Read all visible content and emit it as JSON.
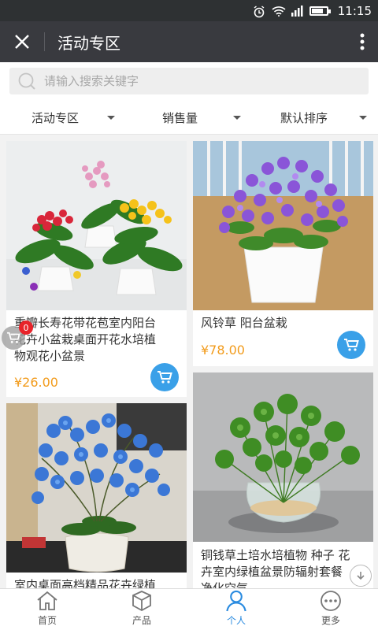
{
  "statusbar": {
    "time": "11:15",
    "icons": [
      "alarm-icon",
      "wifi-icon",
      "signal-icon",
      "battery-icon"
    ]
  },
  "titlebar": {
    "title": "活动专区",
    "close_icon": "close-icon",
    "more_icon": "more-vertical-icon"
  },
  "search": {
    "placeholder": "请输入搜索关键字",
    "icon": "search-icon"
  },
  "filters": [
    {
      "label": "活动专区"
    },
    {
      "label": "销售量"
    },
    {
      "label": "默认排序"
    }
  ],
  "products": [
    {
      "name": "重瓣长寿花带花苞室内阳台花卉小盆栽桌面开花水培植物观花小盆景",
      "name_lines": [
        "重瓣长寿花带花苞室内阳台",
        "花卉小盆栽桌面开花水培植",
        "物观花小盆景"
      ],
      "price": "¥26.00"
    },
    {
      "name": "风铃草 阳台盆栽",
      "name_lines": [
        "风铃草 阳台盆栽"
      ],
      "price": "¥78.00"
    },
    {
      "name": "室内桌面高档精品花卉绿植",
      "name_lines": [
        "室内桌面高档精品花卉绿植"
      ],
      "price": ""
    },
    {
      "name": "铜钱草土培水培植物 种子 花卉室内绿植盆景防辐射套餐净化空气",
      "name_lines": [
        "铜钱草土培水培植物 种子 花",
        "卉室内绿植盆景防辐射套餐",
        "净化空气"
      ],
      "price": ""
    }
  ],
  "cart_badge": "0",
  "tabbar": [
    {
      "label": "首页",
      "icon": "home-icon"
    },
    {
      "label": "产品",
      "icon": "box-icon"
    },
    {
      "label": "个人",
      "icon": "user-icon"
    },
    {
      "label": "更多",
      "icon": "more-horizontal-icon"
    }
  ],
  "colors": {
    "accent": "#2a8be0",
    "price": "#f29b1b",
    "cart_button": "#3aa0e8",
    "titlebar": "#393a3f"
  }
}
